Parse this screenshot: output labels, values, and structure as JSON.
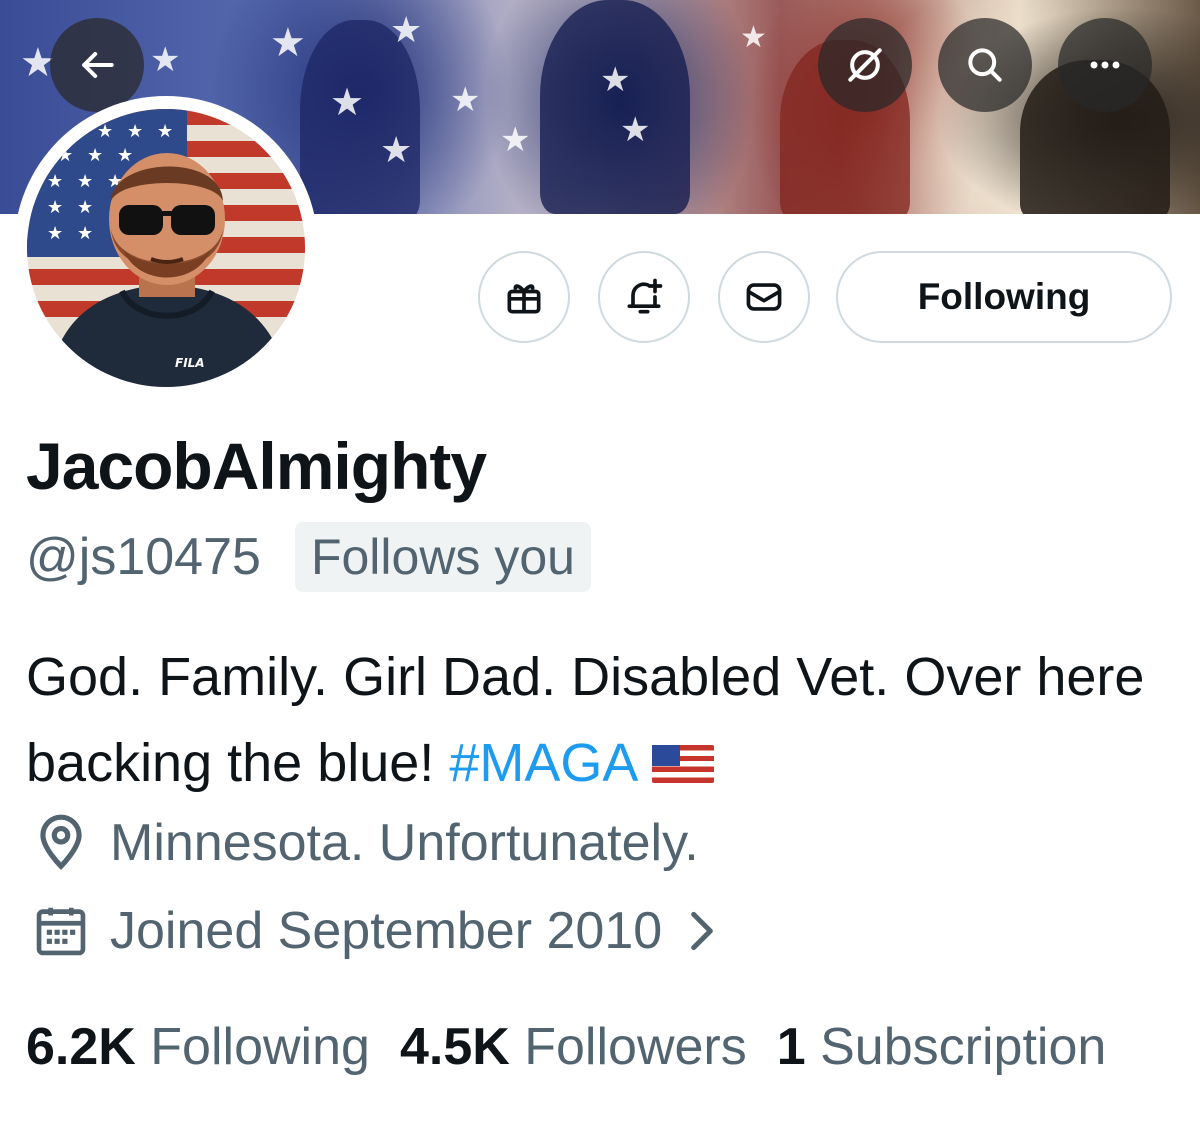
{
  "header": {
    "back_icon": "arrow-left-icon",
    "grok_icon": "grok-icon",
    "search_icon": "search-icon",
    "more_icon": "more-horizontal-icon"
  },
  "actions": {
    "gift_icon": "gift-icon",
    "notify_icon": "bell-plus-icon",
    "message_icon": "envelope-icon",
    "following_label": "Following"
  },
  "profile": {
    "avatar_text": "FILA",
    "display_name": "JacobAlmighty",
    "handle": "@js10475",
    "follows_you": "Follows you",
    "bio_text": "God. Family. Girl Dad. Disabled Vet. Over here backing the blue! ",
    "bio_hashtag": "#MAGA",
    "bio_emoji": "us-flag-emoji",
    "location": "Minnesota. Unfortunately.",
    "joined": "Joined September 2010"
  },
  "stats": {
    "following_count": "6.2K",
    "following_label": "Following",
    "followers_count": "4.5K",
    "followers_label": "Followers",
    "subscriptions_count": "1",
    "subscriptions_label": "Subscription"
  },
  "colors": {
    "text_primary": "#0f1419",
    "text_secondary": "#536471",
    "accent": "#1d9bf0",
    "border": "#cfd9de",
    "badge_bg": "#eff3f4"
  }
}
